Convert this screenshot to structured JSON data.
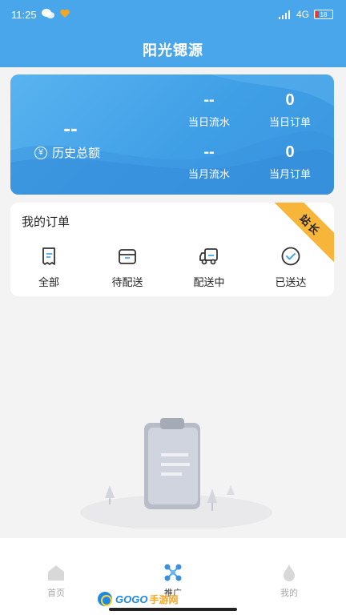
{
  "status_bar": {
    "time": "11:25",
    "network": "4G",
    "battery": "18"
  },
  "header": {
    "title": "阳光锶源"
  },
  "stats": {
    "history_value": "--",
    "history_label": "历史总额",
    "day_flow_value": "--",
    "day_flow_label": "当日流水",
    "day_orders_value": "0",
    "day_orders_label": "当日订单",
    "month_flow_value": "--",
    "month_flow_label": "当月流水",
    "month_orders_value": "0",
    "month_orders_label": "当月订单"
  },
  "orders": {
    "title": "我的订单",
    "ribbon": "站长",
    "items": [
      {
        "label": "全部",
        "icon": "receipt-icon"
      },
      {
        "label": "待配送",
        "icon": "box-icon"
      },
      {
        "label": "配送中",
        "icon": "truck-icon"
      },
      {
        "label": "已送达",
        "icon": "check-circle-icon"
      }
    ]
  },
  "bottom_nav": {
    "items": [
      {
        "label": "首页",
        "icon": "home-icon"
      },
      {
        "label": "推广",
        "icon": "share-network-icon"
      },
      {
        "label": "我的",
        "icon": "user-drop-icon"
      }
    ]
  },
  "watermark": {
    "text_a": "GOGO",
    "text_b": "手游网"
  },
  "colors": {
    "primary": "#4aa6ea",
    "ribbon": "#f7b53a"
  }
}
